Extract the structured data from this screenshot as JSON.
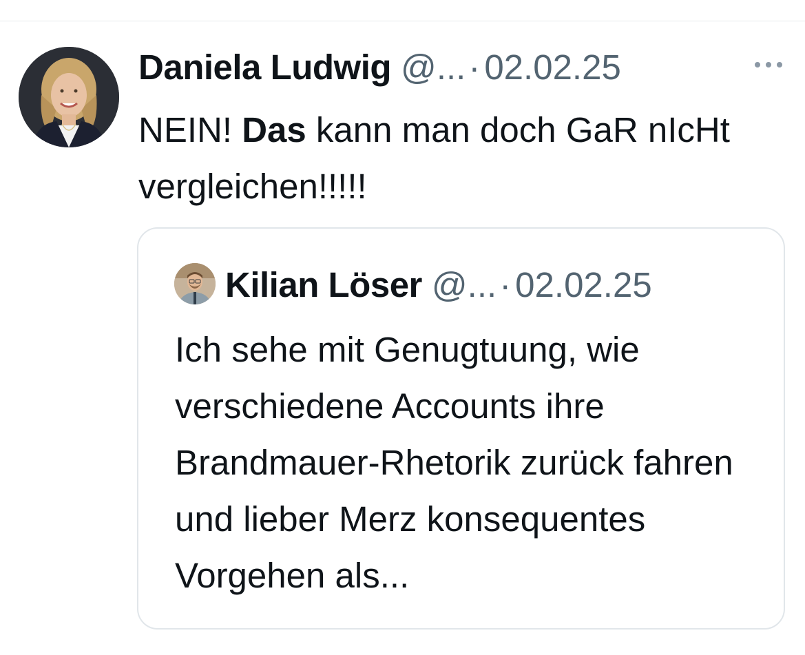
{
  "tweet": {
    "author": {
      "display_name": "Daniela Ludwig",
      "handle": "@...",
      "avatar_icon": "avatar-photo"
    },
    "separator": "·",
    "date": "02.02.25",
    "more_icon": "more-horizontal-icon",
    "text": {
      "part1": "NEIN! ",
      "bold": "Das",
      "part2": " kann man doch GaR nIcHt vergleichen!!!!!"
    }
  },
  "quoted_tweet": {
    "author": {
      "display_name": "Kilian Löser",
      "handle": "@...",
      "avatar_icon": "avatar-photo"
    },
    "separator": "·",
    "date": "02.02.25",
    "text": "Ich sehe mit Genugtuung, wie verschiedene Accounts ihre Brandmauer-Rhetorik zurück fahren und lieber Merz konsequentes Vorgehen als..."
  },
  "colors": {
    "primary_text": "#0f1419",
    "secondary_text": "#536471",
    "border": "#e1e6ea"
  }
}
